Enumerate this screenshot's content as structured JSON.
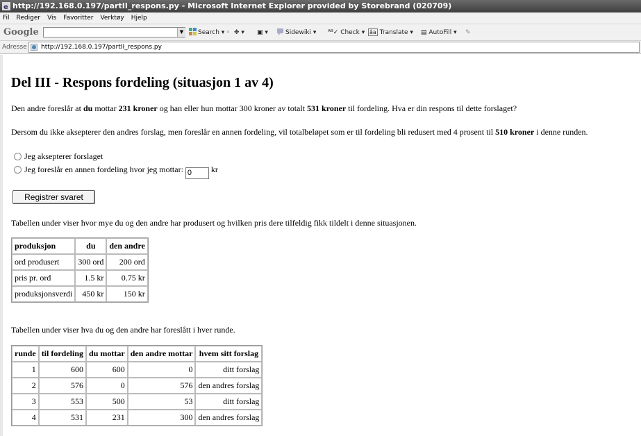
{
  "window": {
    "title": "http://192.168.0.197/partII_respons.py - Microsoft Internet Explorer provided by Storebrand (020709)"
  },
  "menu": [
    "Fil",
    "Rediger",
    "Vis",
    "Favoritter",
    "Verktøy",
    "Hjelp"
  ],
  "toolbar": {
    "google_logo": "Google",
    "search": "Search",
    "sidewiki": "Sidewiki",
    "check": "Check",
    "translate": "Translate",
    "autofill": "AutoFill"
  },
  "address": {
    "label": "Adresse",
    "url": "http://192.168.0.197/partII_respons.py"
  },
  "page": {
    "heading": "Del III - Respons fordeling (situasjon 1 av 4)",
    "intro": {
      "p1": "Den andre foreslår at ",
      "du": "du",
      "p2": " mottar ",
      "amount1": "231 kroner",
      "p3": " og han eller hun mottar 300 kroner av totalt ",
      "total": "531 kroner",
      "p4": " til fordeling. Hva er din respons til dette forslaget?"
    },
    "reduction": {
      "p1": "Dersom du ikke aksepterer den andres forslag, men foreslår en annen fordeling, vil totalbeløpet som er til fordeling bli redusert med 4 prosent til ",
      "amount": "510 kroner",
      "p2": " i denne runden."
    },
    "option_accept": "Jeg aksepterer forslaget",
    "option_propose": "Jeg foreslår en annen fordeling hvor jeg mottar:",
    "propose_value": "0",
    "propose_unit": "kr",
    "submit": "Registrer svaret",
    "table1_caption": "Tabellen under viser hvor mye du og den andre har produsert og hvilken pris dere tilfeldig fikk tildelt i denne situasjonen.",
    "table1": {
      "headers": [
        "produksjon",
        "du",
        "den andre"
      ],
      "rows": [
        [
          "ord produsert",
          "300 ord",
          "200 ord"
        ],
        [
          "pris pr. ord",
          "1.5 kr",
          "0.75 kr"
        ],
        [
          "produksjonsverdi",
          "450 kr",
          "150 kr"
        ]
      ]
    },
    "table2_caption": "Tabellen under viser hva du og den andre har foreslått i hver runde.",
    "table2": {
      "headers": [
        "runde",
        "til fordeling",
        "du mottar",
        "den andre mottar",
        "hvem sitt forslag"
      ],
      "rows": [
        [
          "1",
          "600",
          "600",
          "0",
          "ditt forslag"
        ],
        [
          "2",
          "576",
          "0",
          "576",
          "den andres forslag"
        ],
        [
          "3",
          "553",
          "500",
          "53",
          "ditt forslag"
        ],
        [
          "4",
          "531",
          "231",
          "300",
          "den andres forslag"
        ]
      ]
    }
  }
}
